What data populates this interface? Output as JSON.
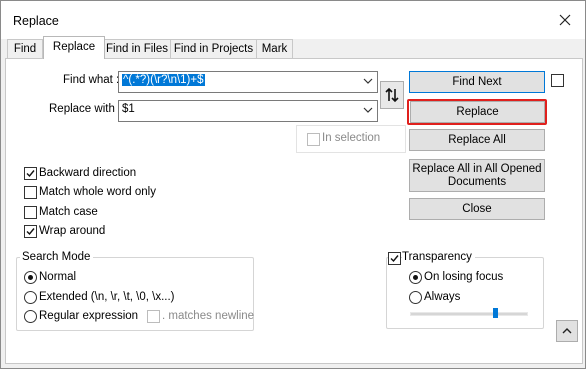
{
  "window": {
    "title": "Replace"
  },
  "tabs": [
    {
      "label": "Find"
    },
    {
      "label": "Replace"
    },
    {
      "label": "Find in Files"
    },
    {
      "label": "Find in Projects"
    },
    {
      "label": "Mark"
    }
  ],
  "form": {
    "find_label": "Find what :",
    "find_value": "^(.*?)(\\r?\\n\\1)+$",
    "replace_label": "Replace with :",
    "replace_value": "$1"
  },
  "buttons": {
    "find_next": "Find Next",
    "replace": "Replace",
    "replace_all": "Replace All",
    "replace_all_opened_line1": "Replace All in All Opened",
    "replace_all_opened_line2": "Documents",
    "close": "Close"
  },
  "in_selection": {
    "label": "In selection",
    "checked": false,
    "disabled": true
  },
  "options": [
    {
      "label": "Backward direction",
      "checked": true
    },
    {
      "label": "Match whole word only",
      "checked": false
    },
    {
      "label": "Match case",
      "checked": false
    },
    {
      "label": "Wrap around",
      "checked": true
    }
  ],
  "search_mode": {
    "title": "Search Mode",
    "options": [
      {
        "label": "Normal",
        "selected": true
      },
      {
        "label": "Extended (\\n, \\r, \\t, \\0, \\x...)",
        "selected": false
      },
      {
        "label": "Regular expression",
        "selected": false
      }
    ],
    "matches_newline": ". matches newline"
  },
  "transparency": {
    "label": "Transparency",
    "checked": true,
    "options": [
      {
        "label": "On losing focus",
        "selected": true
      },
      {
        "label": "Always",
        "selected": false
      }
    ],
    "level": 0.73
  },
  "icons": {
    "swap": "swap-arrows-icon",
    "close": "close-icon",
    "collapse": "chevron-up-icon"
  },
  "colors": {
    "selection": "#0078d7",
    "highlight_box": "#e0201d",
    "button_face": "#e1e1e1"
  }
}
